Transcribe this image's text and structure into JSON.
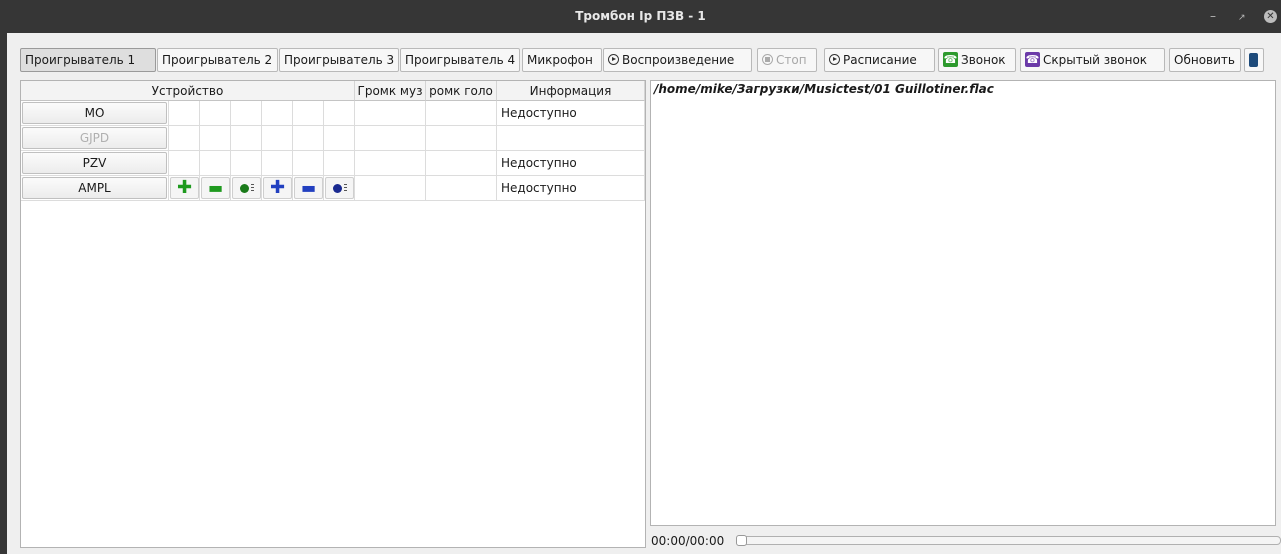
{
  "window": {
    "title": "Тромбон Ip ПЗВ - 1"
  },
  "toolbar": {
    "player1": "Проигрыватель 1",
    "player2": "Проигрыватель 2",
    "player3": "Проигрыватель 3",
    "player4": "Проигрыватель 4",
    "microphone": "Микрофон",
    "playback": "Воспроизведение",
    "stop": "Стоп",
    "schedule": "Расписание",
    "call": "Звонок",
    "hidden_call": "Скрытый звонок",
    "refresh": "Обновить"
  },
  "table": {
    "headers": {
      "device": "Устройство",
      "music_volume": "Громк муз",
      "voice_volume": "ромк голо",
      "info": "Информация"
    },
    "rows": [
      {
        "device": "MO",
        "enabled": true,
        "info": "Недоступно",
        "controls": false
      },
      {
        "device": "GJPD",
        "enabled": false,
        "info": "",
        "controls": false
      },
      {
        "device": "PZV",
        "enabled": true,
        "info": "Недоступно",
        "controls": false
      },
      {
        "device": "AMPL",
        "enabled": true,
        "info": "Недоступно",
        "controls": true
      }
    ]
  },
  "player": {
    "file_path": "/home/mike/Загрузки/Musictest/01 Guillotiner.flac",
    "time": "00:00/00:00",
    "progress": 0
  },
  "colors": {
    "titlebar": "#363636",
    "green_icon": "#1f9a1f",
    "blue_icon": "#2240c0",
    "call_green": "#2d9a2d",
    "hidden_call_purple": "#6b3aa8"
  }
}
